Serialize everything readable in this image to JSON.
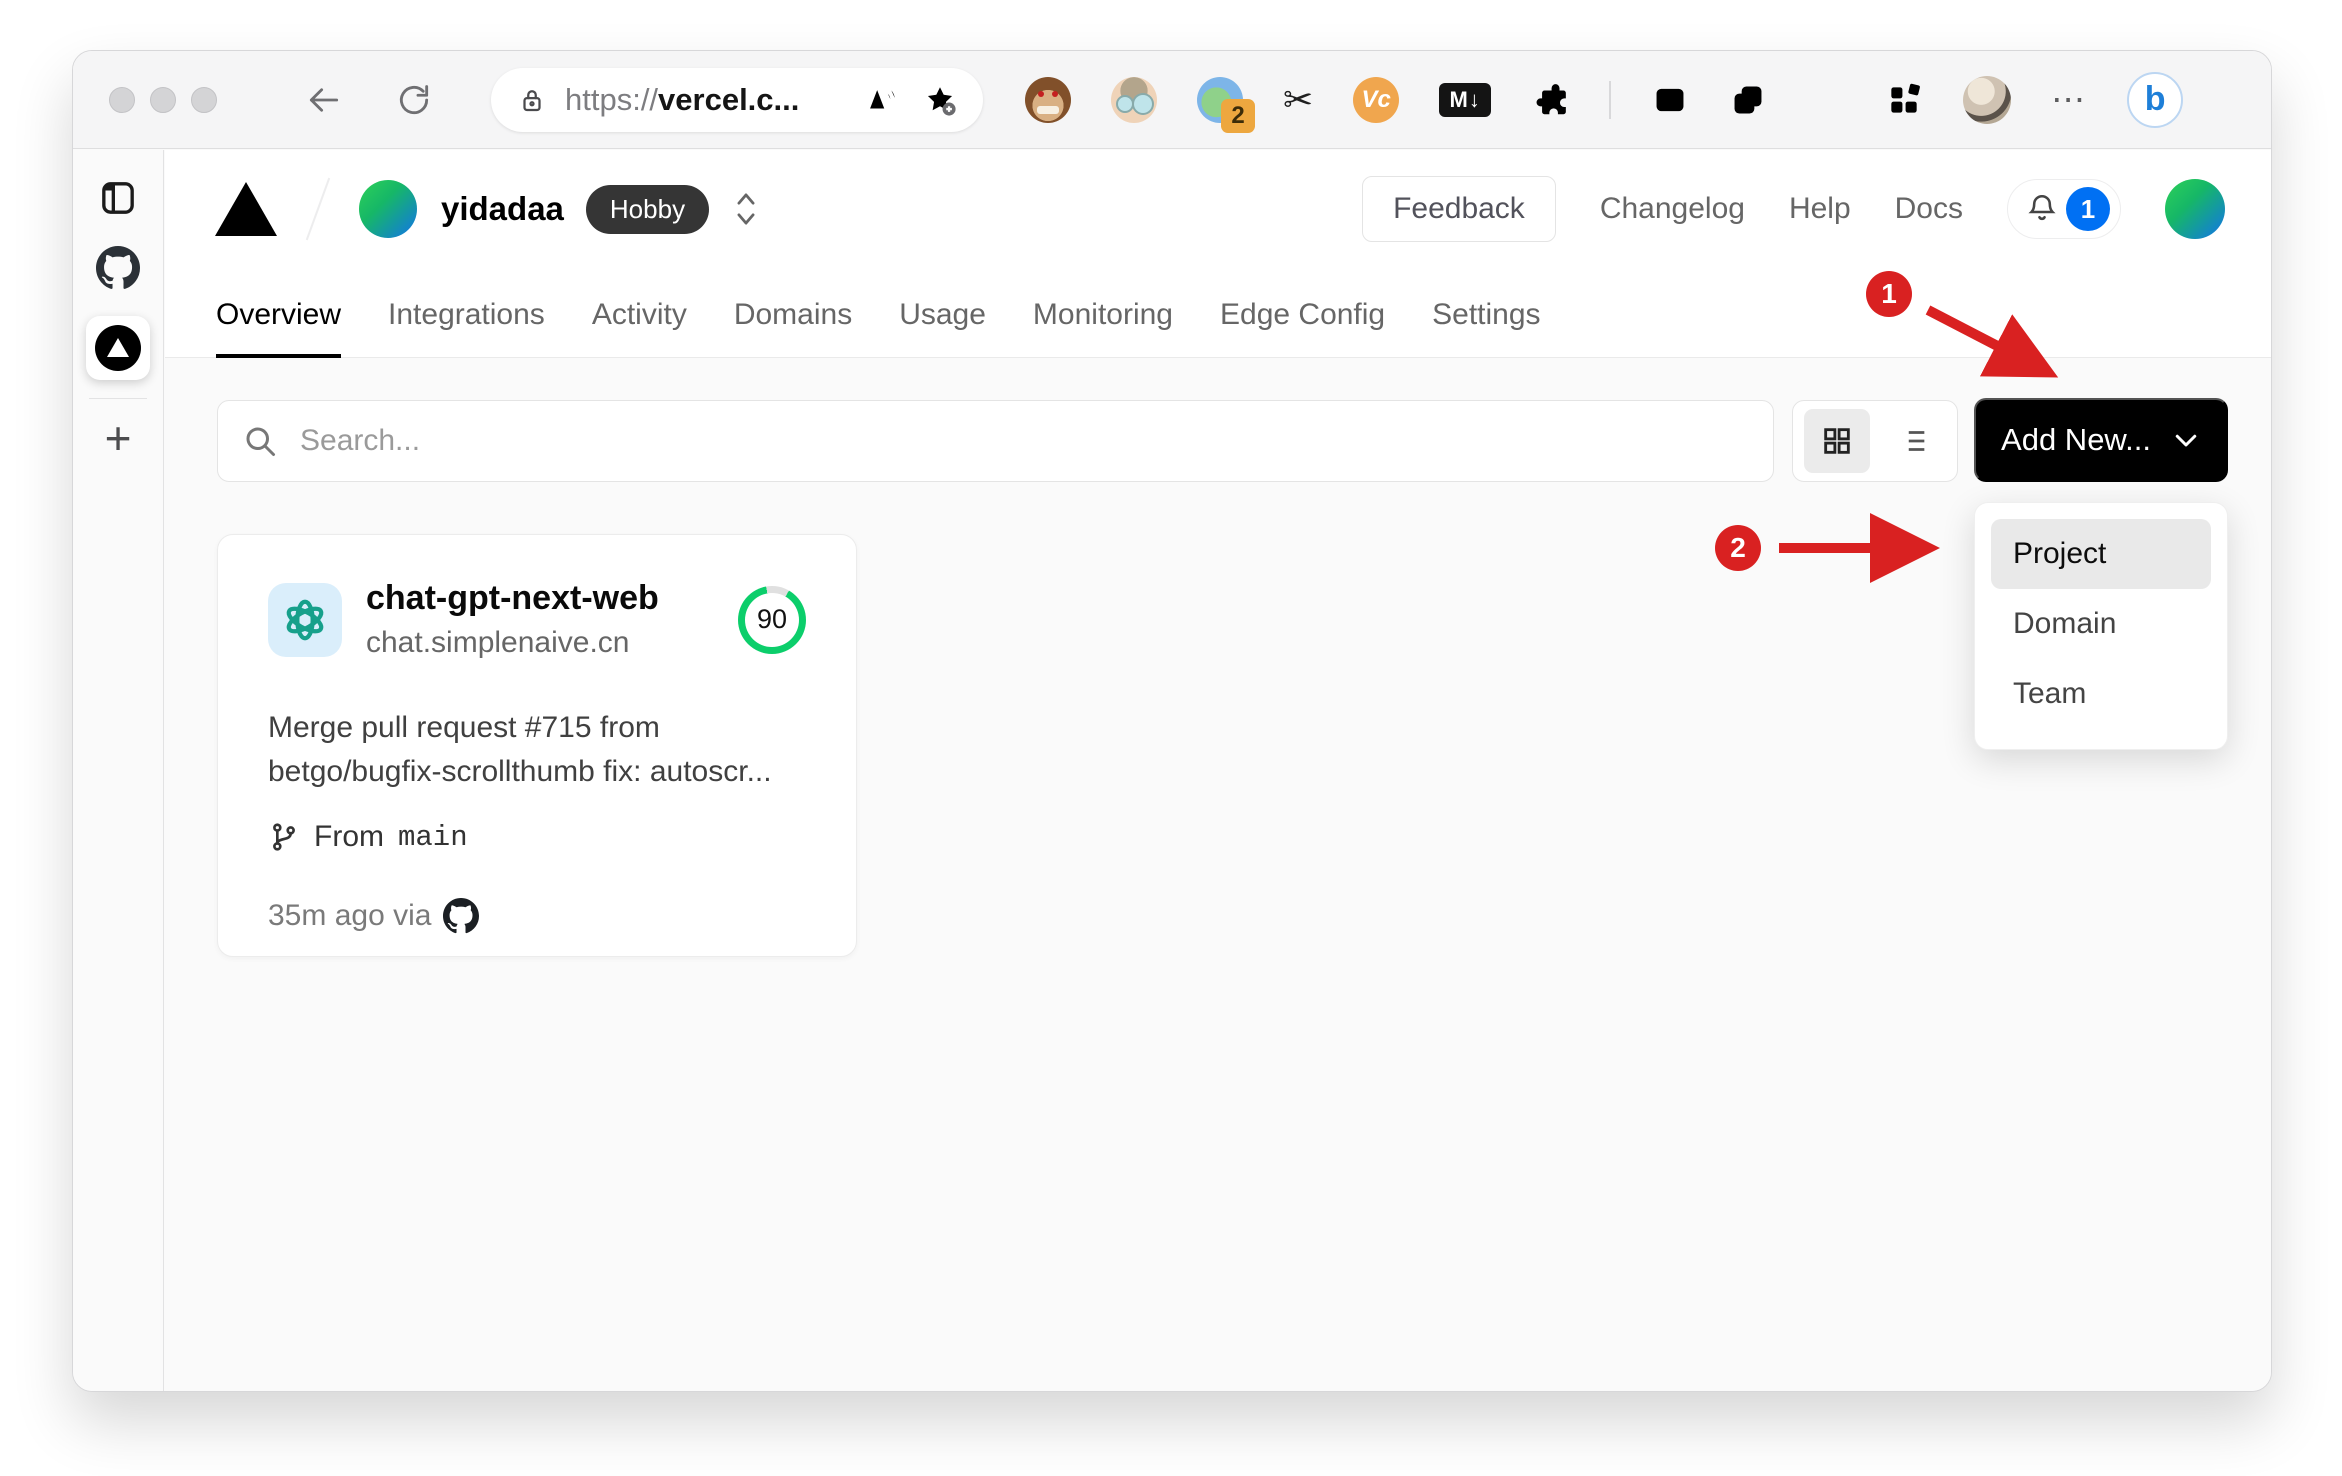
{
  "colors": {
    "annotation_red": "#d92121",
    "vercel_blue": "#0070f3",
    "score_green": "#0cce6b"
  },
  "browser": {
    "address_bar": {
      "scheme": "https://",
      "host": "vercel.c..."
    },
    "extensions": {
      "session_badge": "2",
      "vc_label": "Vc",
      "markdown_label": "M↓",
      "scissors_glyph": "✂",
      "read_aloud_glyph": "A",
      "more_glyph": "⋯",
      "bing_glyph": "b"
    },
    "sidebar": {
      "new_tab_glyph": "+"
    }
  },
  "vercel": {
    "header": {
      "team_name": "yidadaa",
      "plan_badge": "Hobby",
      "feedback_label": "Feedback",
      "changelog_label": "Changelog",
      "help_label": "Help",
      "docs_label": "Docs",
      "notification_count": "1"
    },
    "nav": [
      "Overview",
      "Integrations",
      "Activity",
      "Domains",
      "Usage",
      "Monitoring",
      "Edge Config",
      "Settings"
    ],
    "toolbar": {
      "search_placeholder": "Search...",
      "add_new_label": "Add New..."
    },
    "card": {
      "name": "chat-gpt-next-web",
      "domain": "chat.simplenaive.cn",
      "score": "90",
      "commit_lines": [
        "Merge pull request #715 from",
        "betgo/bugfix-scrollthumb fix: autoscr..."
      ],
      "branch_label": "From",
      "branch_name": "main",
      "meta": "35m ago via"
    },
    "dropdown": {
      "items": [
        "Project",
        "Domain",
        "Team"
      ]
    }
  },
  "annotations": {
    "step1": "1",
    "step2": "2"
  }
}
